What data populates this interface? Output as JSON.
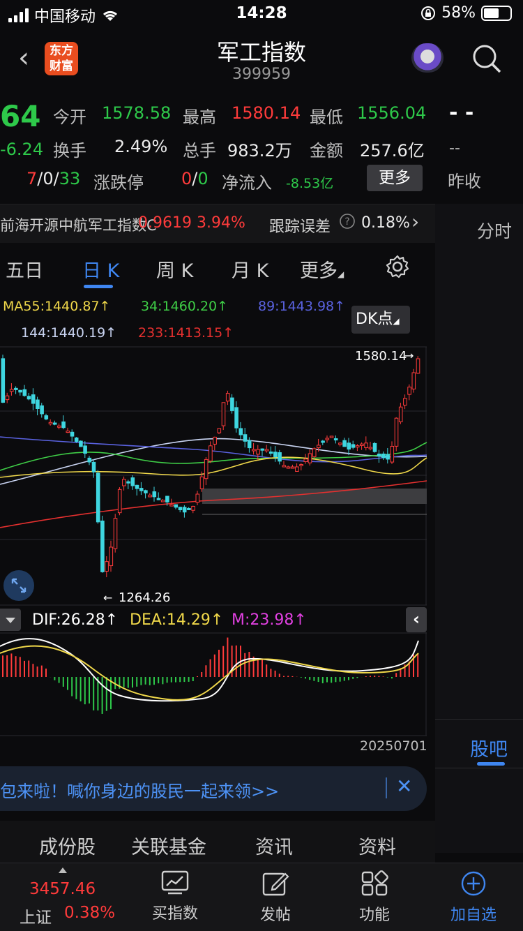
{
  "status": {
    "carrier": "中国移动",
    "time": "14:28",
    "battery": "58%",
    "battery_level": 0.58
  },
  "header": {
    "title": "军工指数",
    "code": "399959",
    "logo_text": "东方财富"
  },
  "quote": {
    "price_partial": "64",
    "change_partial": "-6.24",
    "ratio": {
      "up": "7",
      "flat": "0",
      "down": "33"
    },
    "open_label": "今开",
    "open": "1578.58",
    "high_label": "最高",
    "high": "1580.14",
    "low_label": "最低",
    "low": "1556.04",
    "turnover_label": "换手",
    "turnover": "2.49%",
    "volume_label": "总手",
    "volume": "983.2万",
    "amount_label": "金额",
    "amount": "257.6亿",
    "limit_label": "涨跌停",
    "limit_up": "0",
    "limit_down": "0",
    "netflow_label": "净流入",
    "netflow": "-8.53亿",
    "more_label": "更多",
    "right_dash": "- -",
    "right_dash2": "--",
    "prev_close_label": "昨收"
  },
  "etf": {
    "name": "前海开源中航军工指数C",
    "price": "0.9619",
    "pct": "3.94%",
    "error_label": "跟踪误差",
    "error": "0.18%"
  },
  "right_panel": {
    "fenshi": "分时",
    "guba": "股吧"
  },
  "tabs": {
    "five_day": "五日",
    "day_k": "日 K",
    "week_k": "周 K",
    "month_k": "月 K",
    "more": "更多"
  },
  "ma": {
    "ma55": "MA55:1440.87↑",
    "ma34": "34:1460.20↑",
    "ma89": "89:1443.98↑",
    "ma144": "144:1440.19↑",
    "ma233": "233:1413.15↑",
    "dk_label": "DK点"
  },
  "chart_labels": {
    "high_mark": "1580.14",
    "low_mark": "1264.26",
    "date": "20250701"
  },
  "macd": {
    "dif": "DIF:26.28↑",
    "dea": "DEA:14.29↑",
    "m": "M:23.98↑"
  },
  "banner": {
    "text": "包来啦！喊你身边的股民一起来领>>"
  },
  "subtabs": {
    "components": "成份股",
    "funds": "关联基金",
    "news": "资讯",
    "profile": "资料"
  },
  "bottombar": {
    "index_value": "3457.46",
    "index_name": "上证",
    "index_pct": "0.38%",
    "buy": "买指数",
    "post": "发帖",
    "func": "功能",
    "add": "加自选"
  },
  "colors": {
    "up": "#ff3b3b",
    "down": "#2ec94a",
    "accent": "#3f86f0",
    "k_down": "#3fd6e0"
  }
}
